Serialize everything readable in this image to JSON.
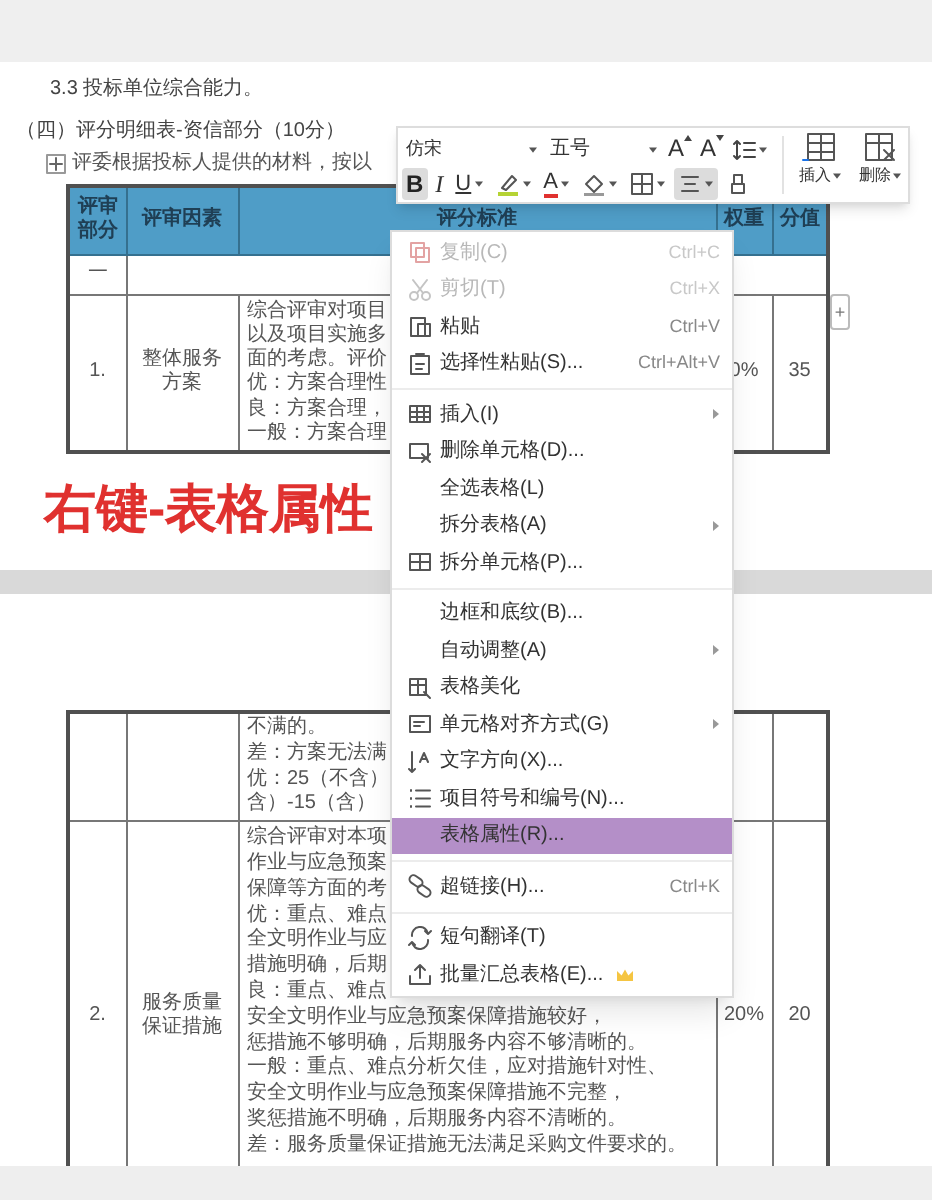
{
  "page_1": {
    "heading_lines": [
      "3.3 投标单位综合能力。",
      "（四）评分明细表-资信部分（10分）"
    ],
    "intro_line": "评委根据投标人提供的材料，按以",
    "table": {
      "columns": [
        "评审部分",
        "评审因素",
        "评分标准",
        "权重",
        "分值"
      ],
      "rows": [
        {
          "kind": "section",
          "number": "一"
        },
        {
          "kind": "item",
          "number": "1.",
          "factor": "整体服务方案",
          "criteria": [
            "综合评审对项目",
            "以及项目实施多",
            "面的考虑。评价",
            "优：方案合理性",
            "良：方案合理，",
            "一般：方案合理"
          ],
          "weight": "0%",
          "score": "35"
        }
      ]
    }
  },
  "add_column_button": "+",
  "caption": "右键-表格属性",
  "page_2": {
    "table": {
      "rows": [
        {
          "kind": "continued",
          "criteria": [
            "不满的。",
            "差：方案无法满",
            "优：25（不含）",
            "含）-15（含）"
          ]
        },
        {
          "kind": "item",
          "number": "2.",
          "factor": "服务质量保证措施",
          "criteria": [
            "综合评审对本项",
            "作业与应急预案",
            "保障等方面的考",
            "优：重点、难点",
            "全文明作业与应",
            "措施明确，后期",
            "良：重点、难点",
            "安全文明作业与应急预案保障措施较好，",
            "惩措施不够明确，后期服务内容不够清晰的。",
            "一般：重点、难点分析欠佳，应对措施针对性、",
            "安全文明作业与应急预案保障措施不完整，",
            "奖惩措施不明确，后期服务内容不清晰的。",
            "差：服务质量保证措施无法满足采购文件要求的。"
          ],
          "weight": "20%",
          "score": "20"
        }
      ]
    }
  },
  "toolbar": {
    "font": "仿宋",
    "font_size": "五号",
    "top_buttons": [
      {
        "kind": "grow-font",
        "label": "A",
        "selected": false
      },
      {
        "kind": "shrink-font",
        "label": "A",
        "selected": false
      },
      {
        "kind": "line-spacing",
        "selected": false
      }
    ],
    "format_buttons": [
      {
        "kind": "bold",
        "label": "B",
        "selected": true
      },
      {
        "kind": "italic",
        "label": "I",
        "selected": false
      },
      {
        "kind": "underline",
        "label": "U",
        "selected": false
      },
      {
        "kind": "highlight",
        "selected": false
      },
      {
        "kind": "font-color",
        "label": "A",
        "selected": false
      },
      {
        "kind": "shading",
        "selected": false
      },
      {
        "kind": "borders",
        "selected": false
      },
      {
        "kind": "align",
        "selected": true
      },
      {
        "kind": "clear",
        "selected": false
      }
    ],
    "large_buttons": [
      {
        "kind": "insert",
        "label": "插入"
      },
      {
        "kind": "delete",
        "label": "删除"
      }
    ]
  },
  "context_menu": {
    "items": [
      {
        "kind": "item",
        "label": "复制(C)",
        "shortcut": "Ctrl+C",
        "disabled": true,
        "submenu": false,
        "selected": false,
        "premium": false
      },
      {
        "kind": "item",
        "label": "剪切(T)",
        "shortcut": "Ctrl+X",
        "disabled": true,
        "submenu": false,
        "selected": false,
        "premium": false
      },
      {
        "kind": "item",
        "label": "粘贴",
        "shortcut": "Ctrl+V",
        "disabled": false,
        "submenu": false,
        "selected": false,
        "premium": false
      },
      {
        "kind": "item",
        "label": "选择性粘贴(S)...",
        "shortcut": "Ctrl+Alt+V",
        "disabled": false,
        "submenu": false,
        "selected": false,
        "premium": false
      },
      {
        "kind": "separator"
      },
      {
        "kind": "item",
        "label": "插入(I)",
        "disabled": false,
        "submenu": true,
        "selected": false,
        "premium": false
      },
      {
        "kind": "item",
        "label": "删除单元格(D)...",
        "disabled": false,
        "submenu": false,
        "selected": false,
        "premium": false
      },
      {
        "kind": "item",
        "label": "全选表格(L)",
        "disabled": false,
        "submenu": false,
        "selected": false,
        "premium": false
      },
      {
        "kind": "item",
        "label": "拆分表格(A)",
        "disabled": false,
        "submenu": true,
        "selected": false,
        "premium": false
      },
      {
        "kind": "item",
        "label": "拆分单元格(P)...",
        "disabled": false,
        "submenu": false,
        "selected": false,
        "premium": false
      },
      {
        "kind": "separator"
      },
      {
        "kind": "item",
        "label": "边框和底纹(B)...",
        "disabled": false,
        "submenu": false,
        "selected": false,
        "premium": false
      },
      {
        "kind": "item",
        "label": "自动调整(A)",
        "disabled": false,
        "submenu": true,
        "selected": false,
        "premium": false
      },
      {
        "kind": "item",
        "label": "表格美化",
        "disabled": false,
        "submenu": false,
        "selected": false,
        "premium": false
      },
      {
        "kind": "item",
        "label": "单元格对齐方式(G)",
        "disabled": false,
        "submenu": true,
        "selected": false,
        "premium": false
      },
      {
        "kind": "item",
        "label": "文字方向(X)...",
        "disabled": false,
        "submenu": false,
        "selected": false,
        "premium": false
      },
      {
        "kind": "item",
        "label": "项目符号和编号(N)...",
        "disabled": false,
        "submenu": false,
        "selected": false,
        "premium": false
      },
      {
        "kind": "item",
        "label": "表格属性(R)...",
        "disabled": false,
        "submenu": false,
        "selected": true,
        "premium": false
      },
      {
        "kind": "separator"
      },
      {
        "kind": "item",
        "label": "超链接(H)...",
        "shortcut": "Ctrl+K",
        "disabled": false,
        "submenu": false,
        "selected": false,
        "premium": false
      },
      {
        "kind": "separator"
      },
      {
        "kind": "item",
        "label": "短句翻译(T)",
        "disabled": false,
        "submenu": false,
        "selected": false,
        "premium": false
      },
      {
        "kind": "item",
        "label": "批量汇总表格(E)...",
        "disabled": false,
        "submenu": false,
        "selected": false,
        "premium": true
      }
    ]
  }
}
